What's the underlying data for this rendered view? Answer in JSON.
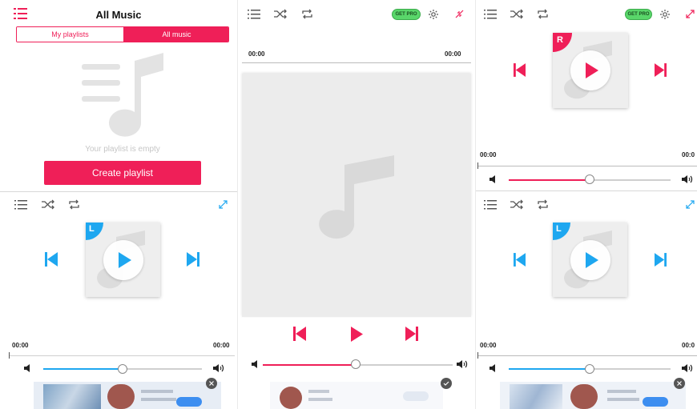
{
  "colors": {
    "accent_red": "#ef1f58",
    "accent_blue": "#1ea7f0",
    "pro_green": "#59d66a",
    "art_bg": "#eeeeee"
  },
  "panel1": {
    "title": "All Music",
    "tabs": [
      "My playlists",
      "All music"
    ],
    "empty_text": "Your playlist is empty",
    "create_button": "Create playlist",
    "player": {
      "badge": "L",
      "time_start": "00:00",
      "time_end": "00:00",
      "volume_level": 0.52
    }
  },
  "panel2": {
    "pro_label": "GET PRO",
    "time_start": "00:00",
    "time_end": "00:00",
    "volume_level": 0.48
  },
  "panel3": {
    "pro_label": "GET PRO",
    "player_top": {
      "badge": "R",
      "time_start": "00:00",
      "time_end": "00:0",
      "volume_level": 0.5
    },
    "player_bottom": {
      "badge": "L",
      "time_start": "00:00",
      "time_end": "00:0",
      "volume_level": 0.5
    }
  },
  "icons": [
    "playlist-icon",
    "shuffle-icon",
    "repeat-icon",
    "settings-icon",
    "expand-icon",
    "collapse-icon",
    "previous-icon",
    "play-icon",
    "next-icon",
    "volume-low-icon",
    "volume-high-icon",
    "music-note-icon",
    "ad-close-icon"
  ]
}
